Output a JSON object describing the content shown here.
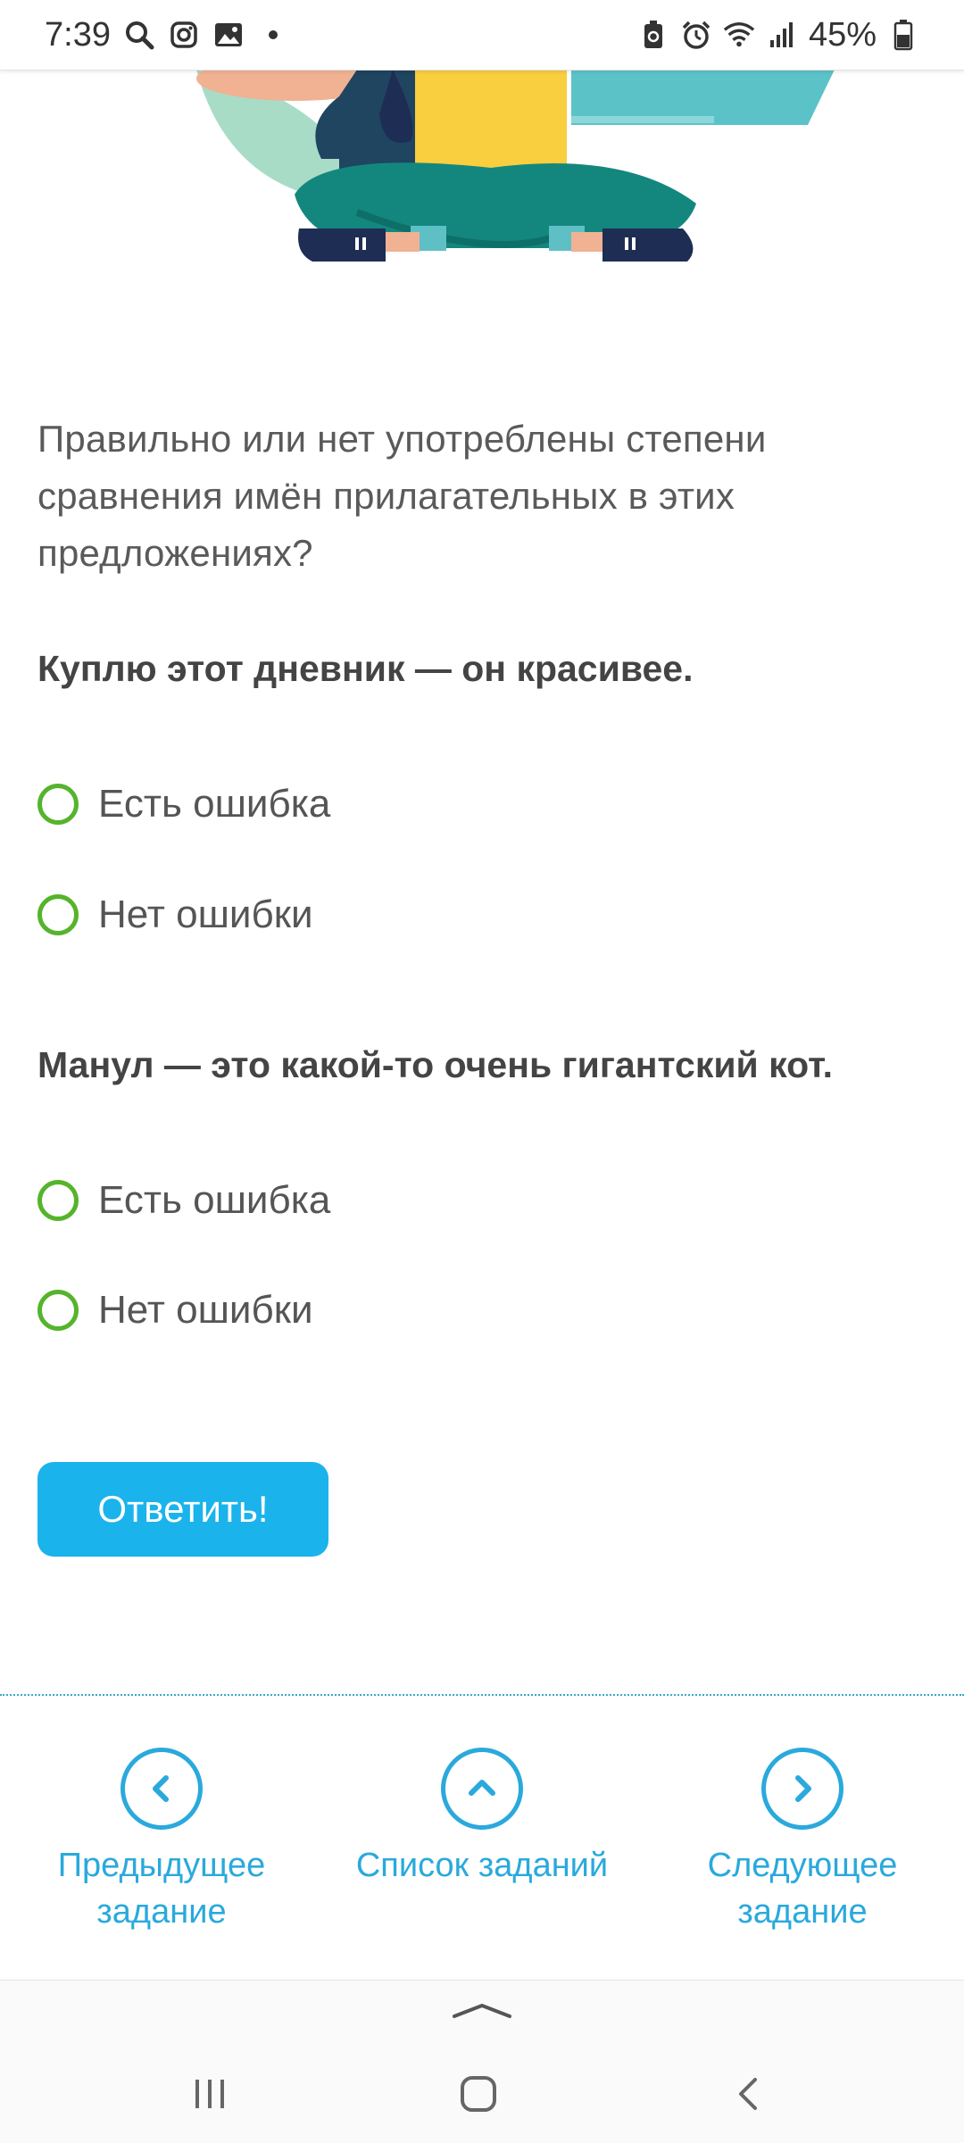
{
  "status_bar": {
    "time": "7:39",
    "battery": "45%",
    "icons_left": [
      "search-icon",
      "instagram-icon",
      "gallery-icon",
      "dot-icon"
    ],
    "icons_right": [
      "battery-saver-icon",
      "alarm-icon",
      "wifi-icon",
      "signal-icon",
      "battery-icon"
    ]
  },
  "question": {
    "text": "Правильно или нет употреблены степени сравнения имён прилагательных в этих предложениях?"
  },
  "items": [
    {
      "sentence": "Куплю этот дневник — он красивее.",
      "options": [
        "Есть ошибка",
        "Нет ошибки"
      ]
    },
    {
      "sentence": "Манул — это какой-то очень гигантский кот.",
      "options": [
        "Есть ошибка",
        "Нет ошибки"
      ]
    }
  ],
  "answer_button": {
    "label": "Ответить!"
  },
  "navigation": {
    "prev": {
      "line1": "Предыдущее",
      "line2": "задание",
      "icon": "chevron-left-icon"
    },
    "list": {
      "label": "Список заданий",
      "icon": "chevron-up-icon"
    },
    "next": {
      "line1": "Следующее",
      "line2": "задание",
      "icon": "chevron-right-icon"
    }
  },
  "system_nav": {
    "icons": [
      "recent-apps-icon",
      "home-icon",
      "back-icon"
    ]
  },
  "colors": {
    "accent": "#1bb3ec",
    "nav_accent": "#2aa9dc",
    "radio_border": "#55b42c"
  }
}
